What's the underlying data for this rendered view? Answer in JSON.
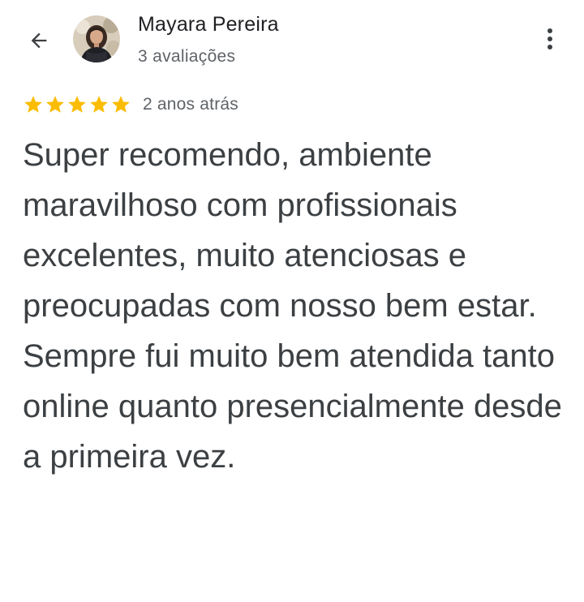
{
  "reviewer": {
    "name": "Mayara Pereira",
    "reviews_count": "3 avaliações"
  },
  "rating": {
    "stars": 5,
    "max_stars": 5,
    "star_color": "#fbbc04",
    "date": "2 anos atrás"
  },
  "review": {
    "paragraph1": "Super recomendo, ambiente maravilhoso com profissionais excelentes, muito atenciosas e preocupadas com nosso bem estar.",
    "paragraph2": "Sempre fui muito bem atendida tanto online quanto presencialmente desde a primeira vez."
  },
  "icons": {
    "back": "arrow-back-icon",
    "more": "more-vert-icon",
    "star": "star-icon"
  }
}
